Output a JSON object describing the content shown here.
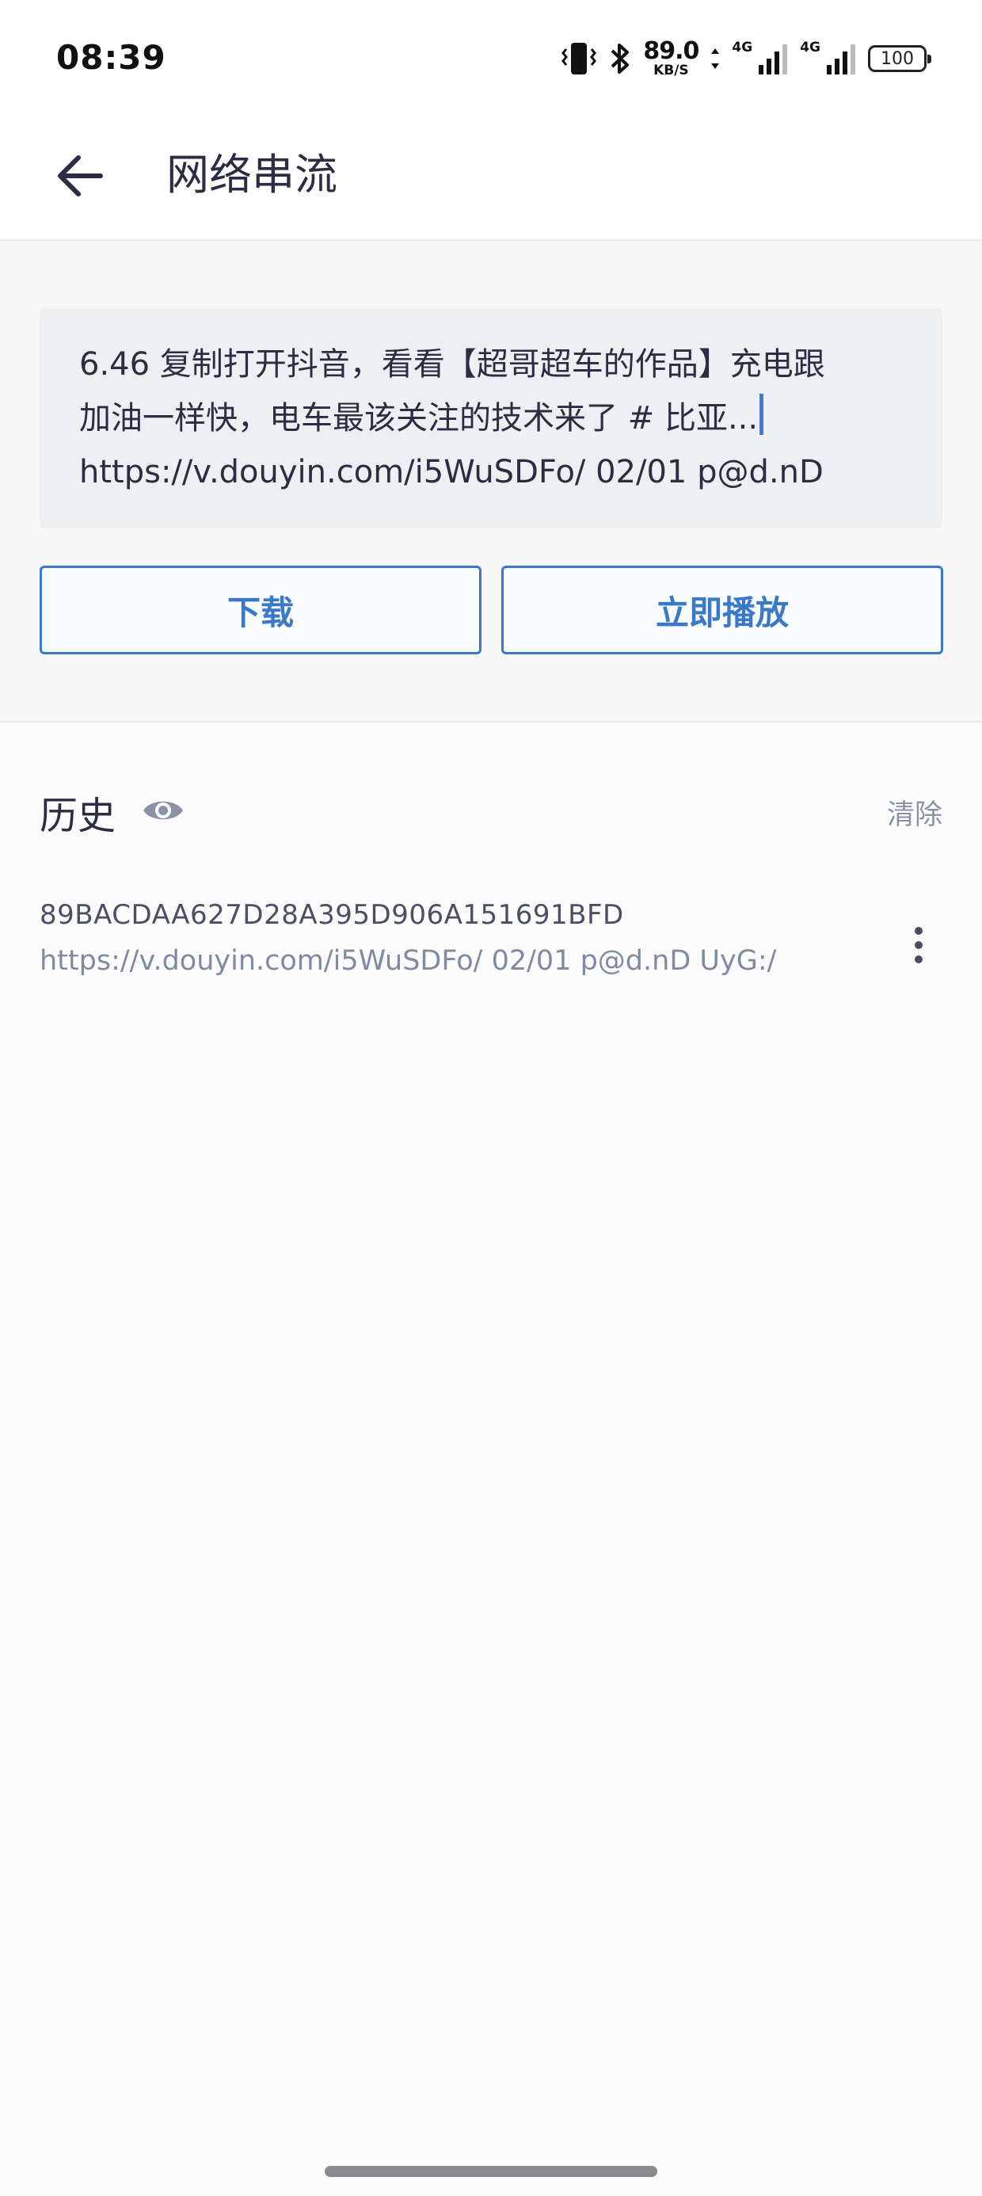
{
  "status_bar": {
    "time": "08:39",
    "net_speed": "89.0",
    "net_speed_unit": "KB/S",
    "sim1_label": "4G",
    "sim2_label": "4G",
    "battery": "100"
  },
  "app_bar": {
    "title": "网络串流",
    "back_icon": "arrow-left-icon"
  },
  "input": {
    "lines": [
      "6.46 复制打开抖音，看看【超哥超车的作品】充电跟",
      "加油一样快，电车最该关注的技术来了 # 比亚...",
      "https://v.douyin.com/i5WuSDFo/ 02/01 p@d.nD"
    ]
  },
  "buttons": {
    "download": "下载",
    "play_now": "立即播放"
  },
  "history": {
    "title": "历史",
    "visibility_icon": "eye-icon",
    "clear": "清除",
    "items": [
      {
        "id": "89BACDAA627D28A395D906A151691BFD",
        "url": "https://v.douyin.com/i5WuSDFo/ 02/01 p@d.nD UyG:/",
        "menu_icon": "more-vertical-icon"
      }
    ]
  },
  "colors": {
    "accent": "#3a78c8",
    "caret": "#3b7ddd",
    "muted_text": "#8a93a6",
    "primary_text": "#2b2d42"
  }
}
